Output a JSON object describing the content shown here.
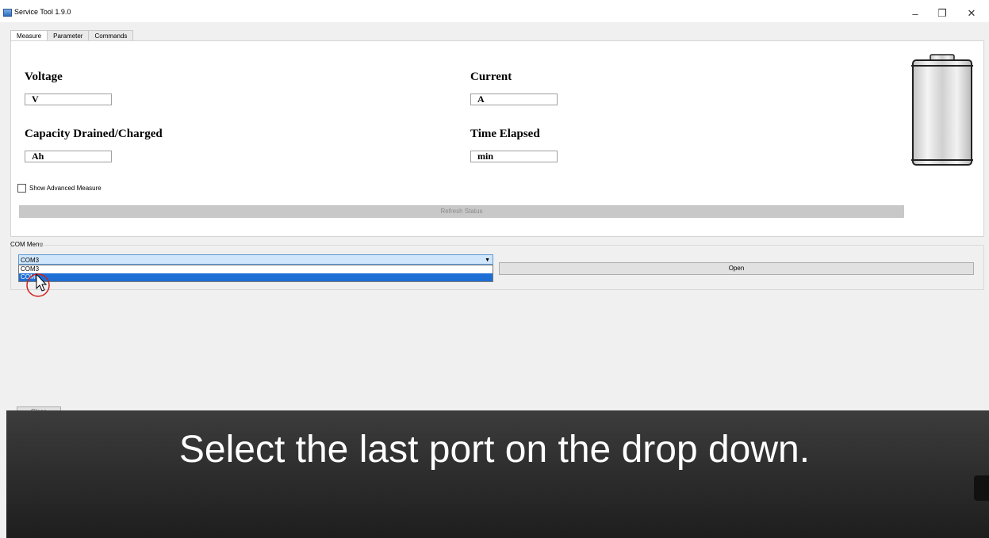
{
  "window": {
    "title": "Service Tool 1.9.0",
    "controls": {
      "minimize": "–",
      "maximize": "❐",
      "close": "✕"
    }
  },
  "tabs": [
    {
      "label": "Measure",
      "active": true
    },
    {
      "label": "Parameter",
      "active": false
    },
    {
      "label": "Commands",
      "active": false
    }
  ],
  "measure": {
    "voltage_label": "Voltage",
    "voltage_unit": "V",
    "current_label": "Current",
    "current_unit": "A",
    "capacity_label": "Capacity Drained/Charged",
    "capacity_unit": "Ah",
    "time_label": "Time Elapsed",
    "time_unit": "min",
    "advanced_checkbox_label": "Show Advanced Measure",
    "advanced_checked": false,
    "refresh_label": "Refresh Status"
  },
  "com_menu": {
    "group_label": "COM Menu",
    "selected": "COM3",
    "options": [
      "COM3",
      "COM4"
    ],
    "highlighted_index": 1,
    "open_label": "Open"
  },
  "close_label": "Close",
  "caption": "Select the last port on the drop down.",
  "colors": {
    "combo_bg": "#cfe6fb",
    "highlight": "#1d6fd6",
    "cursor_ring": "#d0201c"
  },
  "icons": {
    "battery": "battery-icon",
    "cursor": "mouse-pointer-icon"
  }
}
